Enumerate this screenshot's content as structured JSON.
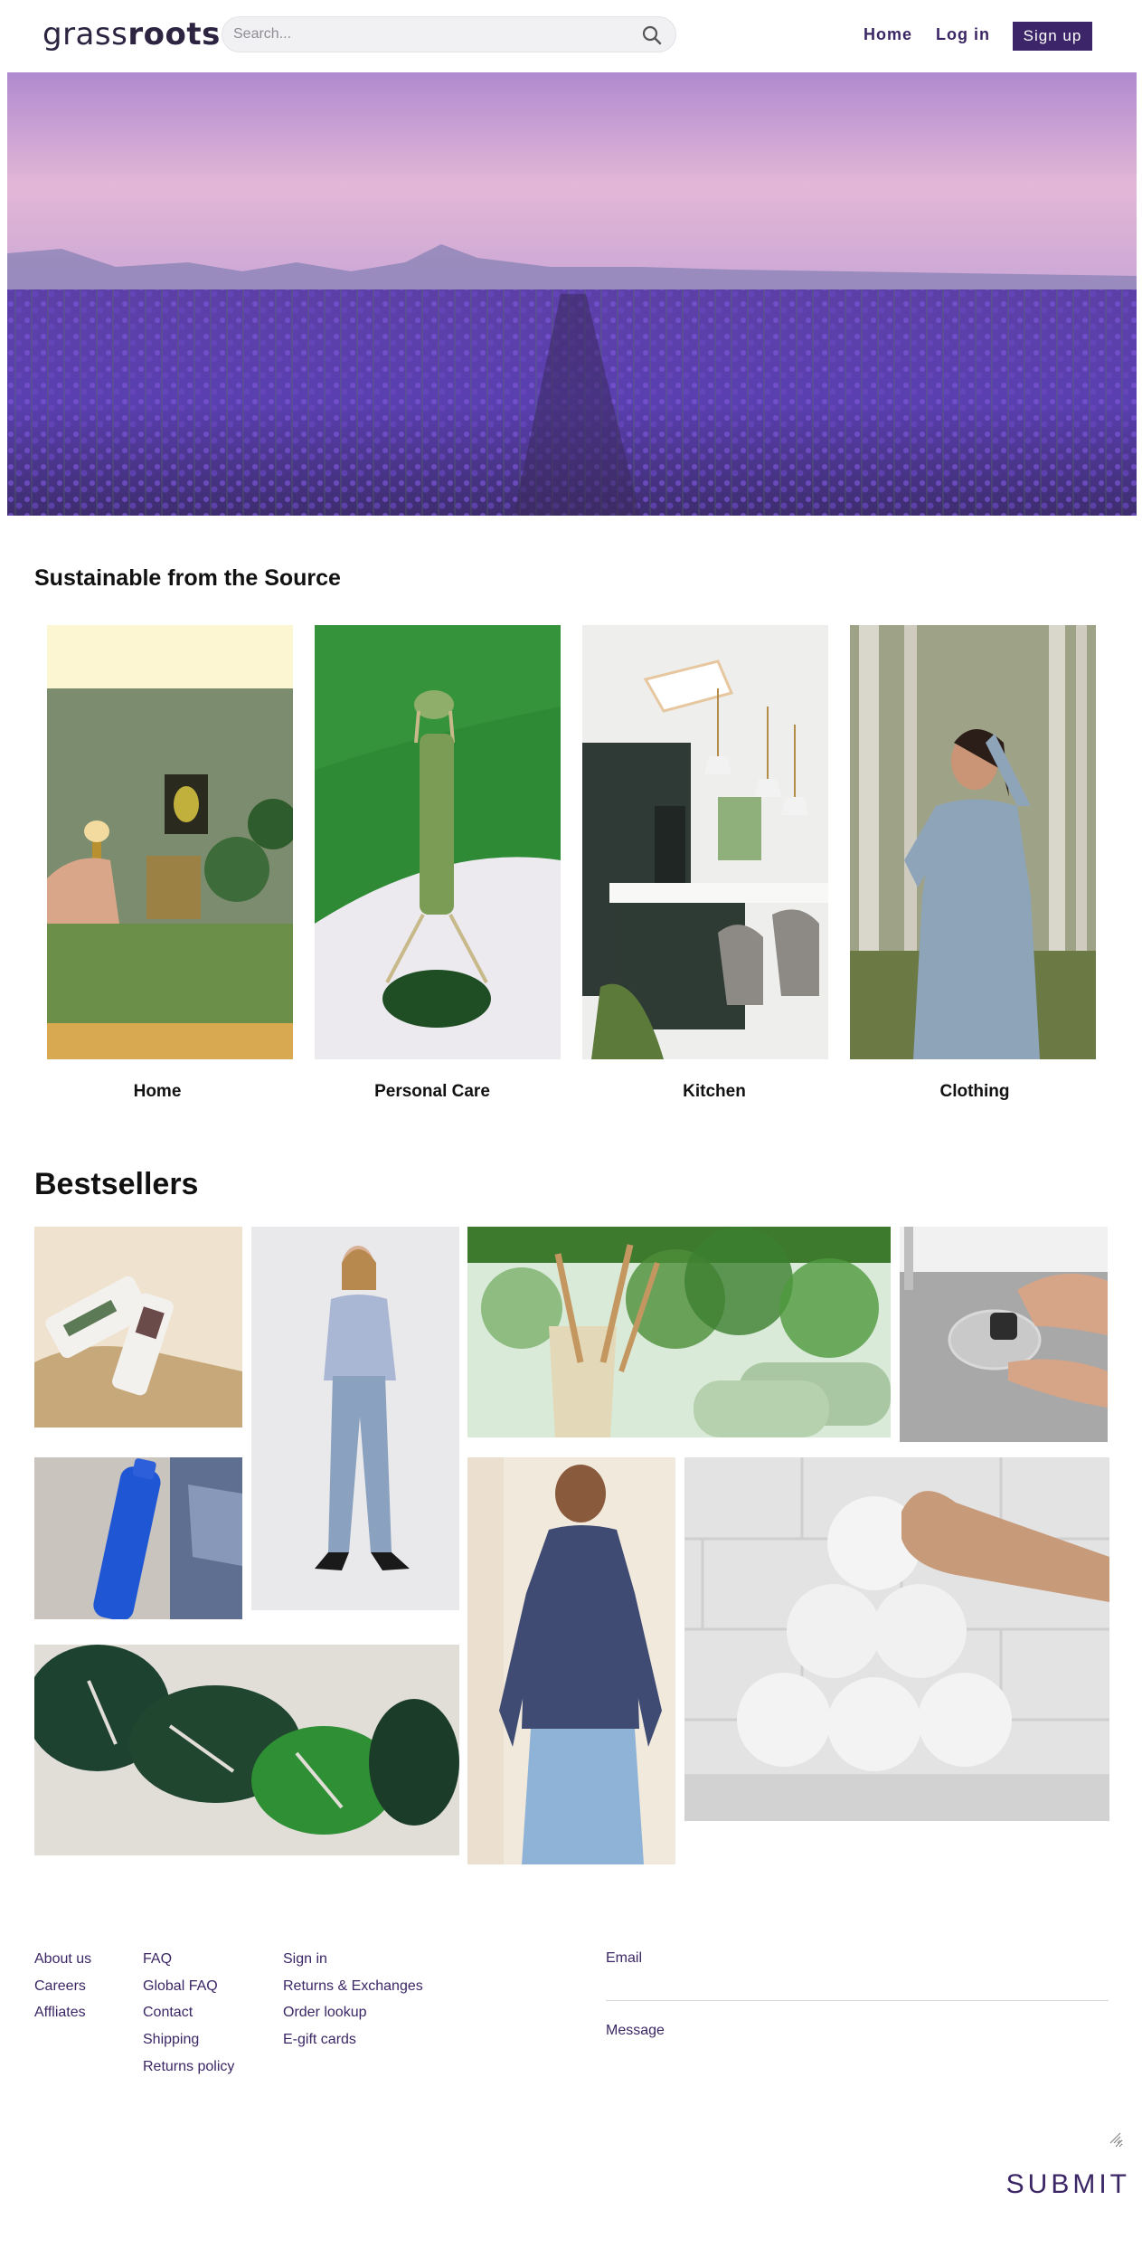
{
  "header": {
    "logo_light": "grass",
    "logo_bold": "roots",
    "search_placeholder": "Search...",
    "nav": {
      "home": "Home",
      "login": "Log in",
      "signup": "Sign up"
    }
  },
  "brand_colors": {
    "primary": "#3c2669",
    "link": "#3b2665",
    "lavender": "#6b46c1"
  },
  "sections": {
    "sustainable_title": "Sustainable from the Source",
    "bestsellers_title": "Bestsellers"
  },
  "categories": [
    {
      "label": "Home"
    },
    {
      "label": "Personal Care"
    },
    {
      "label": "Kitchen"
    },
    {
      "label": "Clothing"
    }
  ],
  "footer": {
    "col1": [
      "About us",
      "Careers",
      "Affliates"
    ],
    "col2": [
      "FAQ",
      "Global FAQ",
      "Contact",
      "Shipping",
      "Returns policy"
    ],
    "col3": [
      "Sign in",
      "Returns & Exchanges",
      "Order lookup",
      "E-gift cards"
    ],
    "email_label": "Email",
    "message_label": "Message",
    "submit_label": "SUBMIT"
  }
}
